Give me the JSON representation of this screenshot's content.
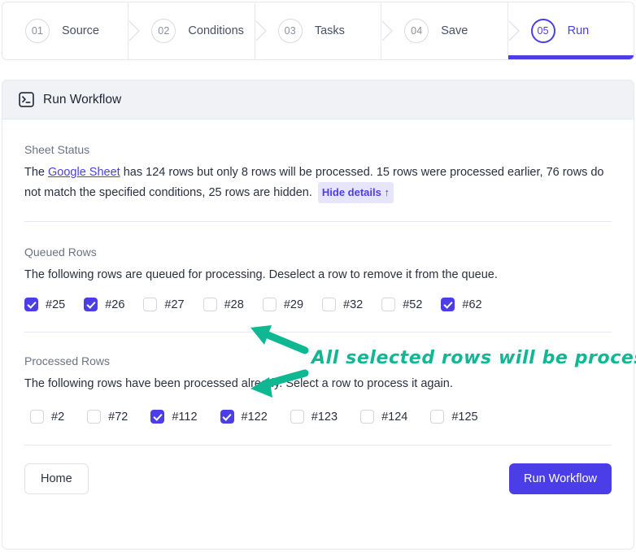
{
  "stepper": {
    "steps": [
      {
        "num": "01",
        "label": "Source",
        "active": false
      },
      {
        "num": "02",
        "label": "Conditions",
        "active": false
      },
      {
        "num": "03",
        "label": "Tasks",
        "active": false
      },
      {
        "num": "04",
        "label": "Save",
        "active": false
      },
      {
        "num": "05",
        "label": "Run",
        "active": true
      }
    ],
    "active_color": "#4b3ee8"
  },
  "card": {
    "header": {
      "icon": "terminal-icon",
      "title": "Run Workflow"
    },
    "sheet_status": {
      "title": "Sheet Status",
      "text_before_link": "The ",
      "link_label": "Google Sheet",
      "text_after_link": " has 124 rows but only 8 rows will be processed. 15 rows were processed earlier, 76 rows do not match the specified conditions, 25 rows are hidden.",
      "toggle_label": "Hide details ↑",
      "total_rows": 124,
      "rows_to_process": 8,
      "rows_processed_earlier": 15,
      "rows_not_matching": 76,
      "rows_hidden": 25
    },
    "queued_rows": {
      "title": "Queued Rows",
      "description": "The following rows are queued for processing. Deselect a row to remove it from the queue.",
      "items": [
        {
          "label": "#25",
          "checked": true
        },
        {
          "label": "#26",
          "checked": true
        },
        {
          "label": "#27",
          "checked": false
        },
        {
          "label": "#28",
          "checked": false
        },
        {
          "label": "#29",
          "checked": false
        },
        {
          "label": "#32",
          "checked": false
        },
        {
          "label": "#52",
          "checked": false
        },
        {
          "label": "#62",
          "checked": true
        }
      ]
    },
    "processed_rows": {
      "title": "Processed Rows",
      "description": "The following rows have been processed already. Select a row to process it again.",
      "items": [
        {
          "label": "#2",
          "checked": false
        },
        {
          "label": "#72",
          "checked": false
        },
        {
          "label": "#112",
          "checked": true
        },
        {
          "label": "#122",
          "checked": true
        },
        {
          "label": "#123",
          "checked": false
        },
        {
          "label": "#124",
          "checked": false
        },
        {
          "label": "#125",
          "checked": false
        }
      ]
    },
    "footer": {
      "home_label": "Home",
      "run_label": "Run Workflow"
    }
  },
  "annotation": {
    "text": "All selected rows will be processed",
    "color": "#10b793"
  }
}
